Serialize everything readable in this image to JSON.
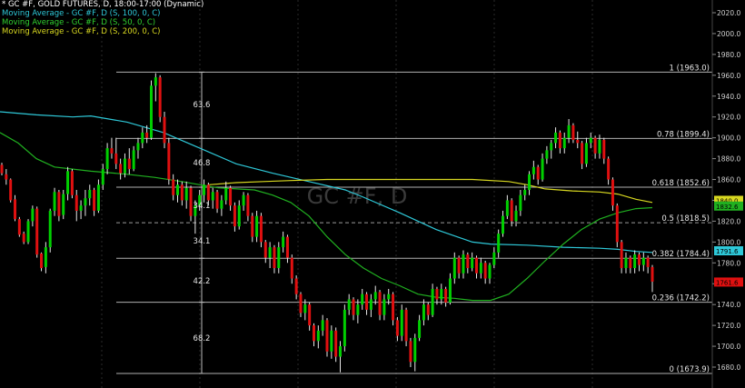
{
  "legend": {
    "header": "* GC #F, GOLD FUTURES, D, 18:00-17:00 (Dynamic)",
    "ma1": "Moving Average - GC #F, D (S, 100, 0, C)",
    "ma2": "Moving Average - GC #F, D (S, 50, 0, C)",
    "ma3": "Moving Average - GC #F, D (S, 200, 0, C)"
  },
  "colors": {
    "up": "#00d000",
    "down": "#e01010",
    "ma100": "#2ec8d8",
    "ma50": "#20b020",
    "ma200": "#d8d820",
    "fib": "#b0b0b0",
    "midline": "#9a9a9a",
    "header": "#ffffff",
    "ma1_text": "#2ec8d8",
    "ma2_text": "#30d030",
    "ma3_text": "#d8d820"
  },
  "chart_data": {
    "type": "candlestick",
    "watermark": "GC #F, D",
    "ylim": [
      1660,
      2030
    ],
    "y_ticks": [
      1680,
      1700,
      1720,
      1740,
      1760,
      1780,
      1800,
      1820,
      1840,
      1860,
      1880,
      1900,
      1920,
      1940,
      1960,
      1980,
      2000,
      2020
    ],
    "y_tick_labels": [
      "1680.0",
      "1700.0",
      "1720.0",
      "1740.0",
      "1760.0",
      "1780.0",
      "1800.0",
      "1820.0",
      "1840.0",
      "1860.0",
      "1880.0",
      "1900.0",
      "1920.0",
      "1940.0",
      "1960.0",
      "1980.0",
      "2000.0",
      "2020.0"
    ],
    "fib_levels": [
      {
        "label": "1 (1963.0)",
        "value": 1963.0,
        "dashed": false
      },
      {
        "label": "0.78 (1899.4)",
        "value": 1899.4,
        "dashed": false
      },
      {
        "label": "0.618 (1852.6)",
        "value": 1852.6,
        "dashed": false
      },
      {
        "label": "0.5 (1818.5)",
        "value": 1818.5,
        "dashed": true
      },
      {
        "label": "0.382 (1784.4)",
        "value": 1784.4,
        "dashed": false
      },
      {
        "label": "0.236 (1742.2)",
        "value": 1742.2,
        "dashed": false
      },
      {
        "label": "0 (1673.9)",
        "value": 1673.9,
        "dashed": false
      }
    ],
    "swing_labels": [
      {
        "text": "63.6",
        "y": 1932
      },
      {
        "text": "46.8",
        "y": 1876
      },
      {
        "text": "34.1",
        "y": 1835
      },
      {
        "text": "34.1",
        "y": 1801
      },
      {
        "text": "42.2",
        "y": 1763
      },
      {
        "text": "68.2",
        "y": 1708
      }
    ],
    "price_tags": [
      {
        "text": "1840.0",
        "value": 1840,
        "color": "#d8d820"
      },
      {
        "text": "1832.6",
        "value": 1834.5,
        "color": "#20b020"
      },
      {
        "text": "1791.6",
        "value": 1791.6,
        "color": "#2ec8d8"
      },
      {
        "text": "1761.6",
        "value": 1761.6,
        "color": "#e01010"
      }
    ],
    "ma100": [
      [
        0,
        1925
      ],
      [
        40,
        1922
      ],
      [
        80,
        1920
      ],
      [
        100,
        1921
      ],
      [
        140,
        1915
      ],
      [
        180,
        1905
      ],
      [
        220,
        1890
      ],
      [
        260,
        1875
      ],
      [
        300,
        1866
      ],
      [
        340,
        1858
      ],
      [
        380,
        1850
      ],
      [
        400,
        1843
      ],
      [
        440,
        1828
      ],
      [
        480,
        1812
      ],
      [
        520,
        1800
      ],
      [
        540,
        1798
      ],
      [
        580,
        1797
      ],
      [
        620,
        1795
      ],
      [
        660,
        1794
      ],
      [
        680,
        1793
      ],
      [
        700,
        1791
      ],
      [
        718,
        1790
      ]
    ],
    "ma50": [
      [
        0,
        1905
      ],
      [
        20,
        1895
      ],
      [
        40,
        1880
      ],
      [
        60,
        1872
      ],
      [
        100,
        1868
      ],
      [
        140,
        1865
      ],
      [
        170,
        1862
      ],
      [
        200,
        1858
      ],
      [
        220,
        1855
      ],
      [
        240,
        1852
      ],
      [
        280,
        1850
      ],
      [
        300,
        1845
      ],
      [
        320,
        1838
      ],
      [
        340,
        1825
      ],
      [
        360,
        1805
      ],
      [
        380,
        1788
      ],
      [
        400,
        1775
      ],
      [
        420,
        1765
      ],
      [
        440,
        1758
      ],
      [
        460,
        1750
      ],
      [
        480,
        1747
      ],
      [
        500,
        1746
      ],
      [
        520,
        1744
      ],
      [
        540,
        1744
      ],
      [
        560,
        1750
      ],
      [
        580,
        1765
      ],
      [
        600,
        1782
      ],
      [
        620,
        1798
      ],
      [
        640,
        1812
      ],
      [
        660,
        1822
      ],
      [
        680,
        1828
      ],
      [
        700,
        1832
      ],
      [
        718,
        1833
      ]
    ],
    "ma200": [
      [
        230,
        1855
      ],
      [
        260,
        1857
      ],
      [
        290,
        1858
      ],
      [
        320,
        1859
      ],
      [
        360,
        1860
      ],
      [
        400,
        1860
      ],
      [
        440,
        1860
      ],
      [
        480,
        1860
      ],
      [
        520,
        1860
      ],
      [
        560,
        1858
      ],
      [
        580,
        1855
      ],
      [
        600,
        1851
      ],
      [
        630,
        1849
      ],
      [
        660,
        1848
      ],
      [
        680,
        1846
      ],
      [
        700,
        1841
      ],
      [
        718,
        1838
      ]
    ],
    "candles": [
      [
        1874,
        1876,
        1864,
        1866
      ],
      [
        1865,
        1870,
        1855,
        1860
      ],
      [
        1860,
        1861,
        1838,
        1840
      ],
      [
        1841,
        1845,
        1820,
        1822
      ],
      [
        1822,
        1824,
        1805,
        1807
      ],
      [
        1808,
        1810,
        1798,
        1800
      ],
      [
        1800,
        1822,
        1798,
        1820
      ],
      [
        1820,
        1835,
        1815,
        1832
      ],
      [
        1832,
        1834,
        1785,
        1788
      ],
      [
        1789,
        1790,
        1772,
        1775
      ],
      [
        1776,
        1800,
        1770,
        1795
      ],
      [
        1795,
        1832,
        1790,
        1830
      ],
      [
        1830,
        1852,
        1825,
        1848
      ],
      [
        1848,
        1850,
        1820,
        1825
      ],
      [
        1826,
        1850,
        1822,
        1846
      ],
      [
        1846,
        1872,
        1840,
        1868
      ],
      [
        1868,
        1870,
        1842,
        1845
      ],
      [
        1845,
        1850,
        1820,
        1830
      ],
      [
        1830,
        1840,
        1822,
        1835
      ],
      [
        1835,
        1850,
        1825,
        1842
      ],
      [
        1842,
        1855,
        1835,
        1850
      ],
      [
        1850,
        1852,
        1825,
        1830
      ],
      [
        1830,
        1860,
        1828,
        1855
      ],
      [
        1855,
        1875,
        1850,
        1870
      ],
      [
        1870,
        1895,
        1865,
        1890
      ],
      [
        1890,
        1900,
        1880,
        1885
      ],
      [
        1885,
        1900,
        1870,
        1875
      ],
      [
        1875,
        1880,
        1860,
        1866
      ],
      [
        1866,
        1885,
        1862,
        1880
      ],
      [
        1880,
        1890,
        1865,
        1870
      ],
      [
        1870,
        1892,
        1868,
        1888
      ],
      [
        1888,
        1900,
        1880,
        1895
      ],
      [
        1895,
        1910,
        1890,
        1905
      ],
      [
        1905,
        1912,
        1895,
        1900
      ],
      [
        1900,
        1955,
        1898,
        1950
      ],
      [
        1950,
        1962,
        1935,
        1958
      ],
      [
        1958,
        1960,
        1915,
        1920
      ],
      [
        1920,
        1925,
        1890,
        1895
      ],
      [
        1895,
        1900,
        1855,
        1860
      ],
      [
        1860,
        1865,
        1840,
        1845
      ],
      [
        1845,
        1860,
        1838,
        1855
      ],
      [
        1855,
        1858,
        1835,
        1840
      ],
      [
        1840,
        1858,
        1832,
        1852
      ],
      [
        1852,
        1854,
        1820,
        1825
      ],
      [
        1825,
        1840,
        1808,
        1835
      ],
      [
        1835,
        1850,
        1830,
        1845
      ],
      [
        1845,
        1860,
        1838,
        1855
      ],
      [
        1855,
        1857,
        1835,
        1840
      ],
      [
        1840,
        1852,
        1832,
        1848
      ],
      [
        1848,
        1850,
        1828,
        1832
      ],
      [
        1832,
        1845,
        1825,
        1840
      ],
      [
        1840,
        1858,
        1836,
        1852
      ],
      [
        1852,
        1854,
        1830,
        1835
      ],
      [
        1835,
        1838,
        1810,
        1815
      ],
      [
        1815,
        1840,
        1812,
        1835
      ],
      [
        1835,
        1848,
        1830,
        1845
      ],
      [
        1845,
        1847,
        1820,
        1825
      ],
      [
        1825,
        1828,
        1800,
        1805
      ],
      [
        1805,
        1830,
        1800,
        1825
      ],
      [
        1825,
        1828,
        1795,
        1800
      ],
      [
        1800,
        1802,
        1780,
        1785
      ],
      [
        1785,
        1800,
        1775,
        1795
      ],
      [
        1795,
        1797,
        1770,
        1775
      ],
      [
        1775,
        1800,
        1770,
        1795
      ],
      [
        1795,
        1810,
        1790,
        1805
      ],
      [
        1805,
        1807,
        1780,
        1785
      ],
      [
        1785,
        1788,
        1760,
        1765
      ],
      [
        1765,
        1768,
        1745,
        1750
      ],
      [
        1750,
        1752,
        1728,
        1732
      ],
      [
        1732,
        1745,
        1725,
        1740
      ],
      [
        1740,
        1742,
        1715,
        1720
      ],
      [
        1720,
        1722,
        1700,
        1705
      ],
      [
        1705,
        1720,
        1698,
        1715
      ],
      [
        1715,
        1730,
        1710,
        1725
      ],
      [
        1725,
        1727,
        1690,
        1695
      ],
      [
        1695,
        1720,
        1688,
        1715
      ],
      [
        1715,
        1718,
        1685,
        1690
      ],
      [
        1690,
        1705,
        1675,
        1700
      ],
      [
        1700,
        1740,
        1695,
        1735
      ],
      [
        1735,
        1750,
        1730,
        1745
      ],
      [
        1745,
        1747,
        1725,
        1730
      ],
      [
        1730,
        1745,
        1722,
        1740
      ],
      [
        1740,
        1755,
        1735,
        1750
      ],
      [
        1750,
        1752,
        1730,
        1735
      ],
      [
        1735,
        1750,
        1728,
        1745
      ],
      [
        1745,
        1758,
        1740,
        1752
      ],
      [
        1752,
        1754,
        1725,
        1730
      ],
      [
        1730,
        1750,
        1725,
        1745
      ],
      [
        1745,
        1755,
        1740,
        1750
      ],
      [
        1750,
        1752,
        1720,
        1725
      ],
      [
        1725,
        1728,
        1705,
        1710
      ],
      [
        1710,
        1740,
        1705,
        1735
      ],
      [
        1735,
        1737,
        1700,
        1705
      ],
      [
        1705,
        1708,
        1680,
        1685
      ],
      [
        1685,
        1712,
        1676,
        1708
      ],
      [
        1708,
        1730,
        1705,
        1725
      ],
      [
        1725,
        1745,
        1720,
        1740
      ],
      [
        1740,
        1742,
        1725,
        1730
      ],
      [
        1730,
        1760,
        1728,
        1755
      ],
      [
        1755,
        1757,
        1740,
        1745
      ],
      [
        1745,
        1760,
        1740,
        1755
      ],
      [
        1755,
        1757,
        1738,
        1742
      ],
      [
        1742,
        1770,
        1740,
        1765
      ],
      [
        1765,
        1790,
        1760,
        1785
      ],
      [
        1785,
        1787,
        1765,
        1770
      ],
      [
        1770,
        1792,
        1765,
        1788
      ],
      [
        1788,
        1790,
        1770,
        1775
      ],
      [
        1775,
        1790,
        1772,
        1785
      ],
      [
        1785,
        1787,
        1765,
        1770
      ],
      [
        1770,
        1785,
        1765,
        1780
      ],
      [
        1780,
        1782,
        1760,
        1765
      ],
      [
        1765,
        1780,
        1760,
        1778
      ],
      [
        1778,
        1795,
        1775,
        1790
      ],
      [
        1790,
        1812,
        1785,
        1808
      ],
      [
        1808,
        1830,
        1805,
        1825
      ],
      [
        1825,
        1845,
        1822,
        1840
      ],
      [
        1840,
        1842,
        1815,
        1820
      ],
      [
        1820,
        1835,
        1815,
        1830
      ],
      [
        1830,
        1850,
        1825,
        1845
      ],
      [
        1845,
        1855,
        1840,
        1850
      ],
      [
        1850,
        1868,
        1845,
        1865
      ],
      [
        1865,
        1878,
        1860,
        1872
      ],
      [
        1872,
        1874,
        1855,
        1860
      ],
      [
        1860,
        1885,
        1858,
        1880
      ],
      [
        1880,
        1892,
        1875,
        1888
      ],
      [
        1888,
        1898,
        1880,
        1895
      ],
      [
        1895,
        1910,
        1890,
        1905
      ],
      [
        1905,
        1907,
        1885,
        1890
      ],
      [
        1890,
        1905,
        1885,
        1900
      ],
      [
        1900,
        1918,
        1895,
        1912
      ],
      [
        1912,
        1914,
        1895,
        1898
      ],
      [
        1898,
        1906,
        1890,
        1895
      ],
      [
        1895,
        1897,
        1870,
        1875
      ],
      [
        1875,
        1900,
        1872,
        1895
      ],
      [
        1895,
        1905,
        1890,
        1900
      ],
      [
        1900,
        1902,
        1880,
        1885
      ],
      [
        1885,
        1903,
        1880,
        1898
      ],
      [
        1898,
        1900,
        1875,
        1880
      ],
      [
        1880,
        1882,
        1855,
        1860
      ],
      [
        1860,
        1862,
        1830,
        1835
      ],
      [
        1835,
        1837,
        1795,
        1800
      ],
      [
        1800,
        1802,
        1770,
        1775
      ],
      [
        1775,
        1790,
        1770,
        1785
      ],
      [
        1785,
        1787,
        1770,
        1775
      ],
      [
        1775,
        1792,
        1770,
        1788
      ],
      [
        1788,
        1790,
        1772,
        1778
      ],
      [
        1778,
        1790,
        1772,
        1785
      ],
      [
        1785,
        1787,
        1770,
        1776
      ],
      [
        1776,
        1778,
        1752,
        1762
      ]
    ]
  }
}
